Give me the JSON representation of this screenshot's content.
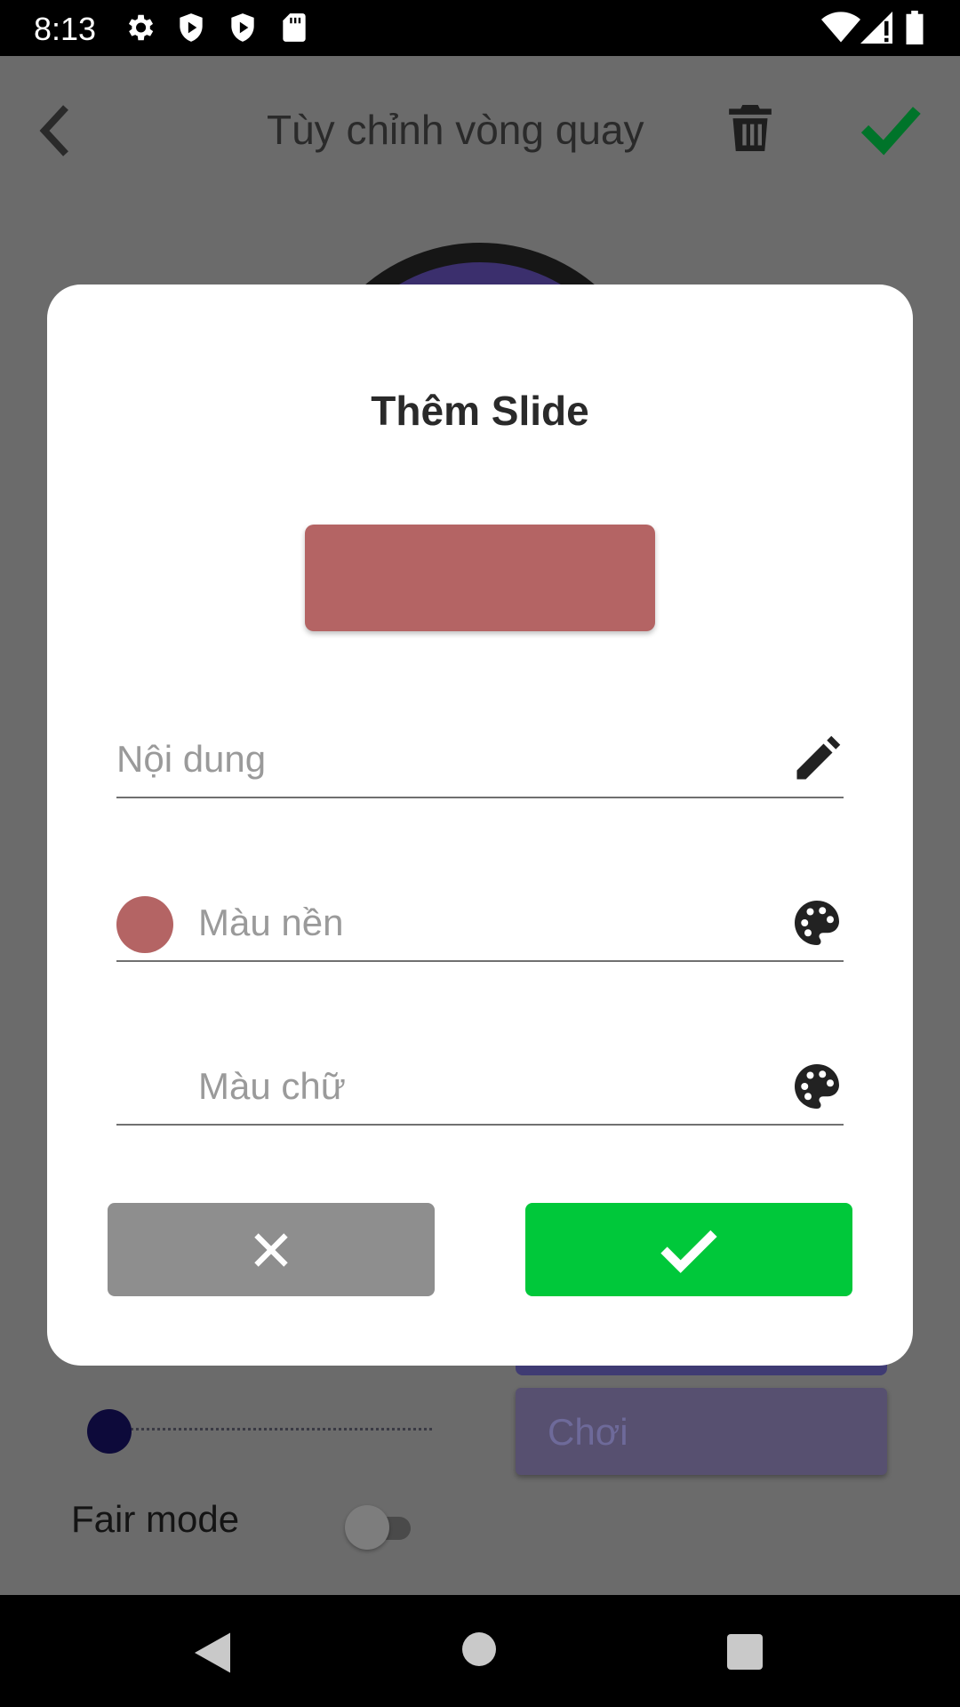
{
  "status_bar": {
    "time": "8:13",
    "icons": [
      "gear-icon",
      "shield-play-icon",
      "shield-play-icon",
      "sd-card-icon",
      "wifi-icon",
      "signal-icon",
      "battery-icon"
    ]
  },
  "app": {
    "title": "Tùy chỉnh vòng quay",
    "play_label": "Chơi",
    "fair_mode_label": "Fair mode",
    "accent_color": "#008a2e"
  },
  "dialog": {
    "title": "Thêm Slide",
    "preview_color": "#b46464",
    "content_field": {
      "placeholder": "Nội dung",
      "icon": "pencil-icon"
    },
    "background_field": {
      "placeholder": "Màu nền",
      "swatch_color": "#b46464",
      "icon": "palette-icon"
    },
    "text_color_field": {
      "placeholder": "Màu chữ",
      "icon": "palette-icon"
    },
    "cancel_button": {
      "icon": "close-icon",
      "color": "#8e8e8e"
    },
    "confirm_button": {
      "icon": "check-icon",
      "color": "#00c83a"
    }
  },
  "nav_bar": {
    "icons": [
      "back-triangle-icon",
      "home-circle-icon",
      "recents-square-icon"
    ]
  }
}
